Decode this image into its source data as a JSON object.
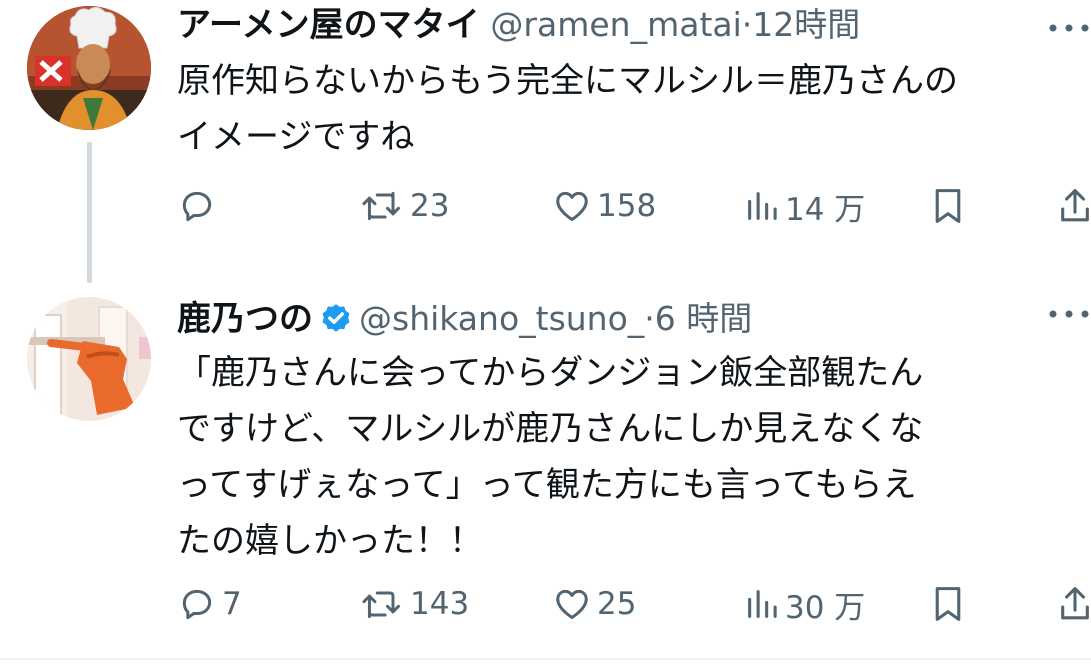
{
  "tweets": [
    {
      "display_name": "アーメン屋のマタイ",
      "handle": "@ramen_matai",
      "separator": "·",
      "time": "12時間",
      "verified": false,
      "body_lines": [
        "原作知らないからもう完全にマルシル＝鹿乃さんの",
        "イメージですね"
      ],
      "actions": {
        "reply": "",
        "retweet": "23",
        "like": "158",
        "views": "14 万"
      }
    },
    {
      "display_name": "鹿乃つの",
      "handle": "@shikano_tsuno_",
      "separator": "·",
      "time": "6 時間",
      "verified": true,
      "body_lines": [
        "「鹿乃さんに会ってからダンジョン飯全部観たん",
        "ですけど、マルシルが鹿乃さんにしか見えなくな",
        "ってすげぇなって」って観た方にも言ってもらえ",
        "たの嬉しかった！！"
      ],
      "actions": {
        "reply": "7",
        "retweet": "143",
        "like": "25",
        "views": "30 万"
      }
    }
  ],
  "icons": {
    "reply": "reply-icon",
    "retweet": "retweet-icon",
    "like": "heart-icon",
    "views": "views-icon",
    "bookmark": "bookmark-icon",
    "share": "share-icon",
    "more": "more-icon",
    "verified": "verified-badge-icon"
  },
  "colors": {
    "text": "#0f1419",
    "secondary": "#536471",
    "verified": "#1d9bf0",
    "thread_line": "#cfd9de"
  }
}
